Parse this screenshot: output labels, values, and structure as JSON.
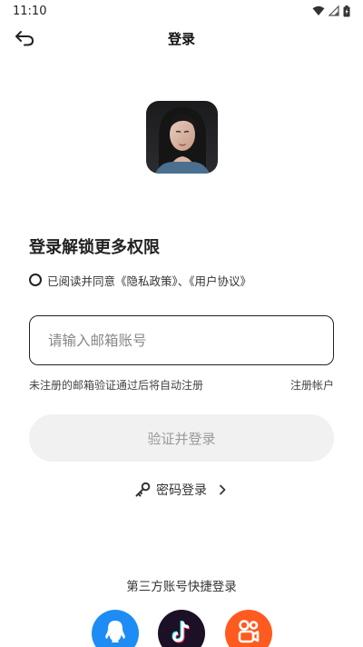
{
  "status_bar": {
    "time": "11:10"
  },
  "header": {
    "title": "登录"
  },
  "login": {
    "headline": "登录解锁更多权限",
    "agreement_text": "已阅读并同意《隐私政策》、《用户协议》",
    "email_placeholder": "请输入邮箱账号",
    "hint": "未注册的邮箱验证通过后将自动注册",
    "register_link": "注册帐户",
    "verify_button": "验证并登录",
    "password_login": "密码登录"
  },
  "third_party": {
    "title": "第三方账号快捷登录",
    "providers": [
      "qq-icon",
      "douyin-icon",
      "kuaishou-icon"
    ]
  },
  "colors": {
    "qq": "#1e8cf5",
    "douyin": "#1c1027",
    "kuaishou": "#ff5a1f",
    "button_bg": "#f1f1f1",
    "button_text": "#9a9a9a"
  }
}
